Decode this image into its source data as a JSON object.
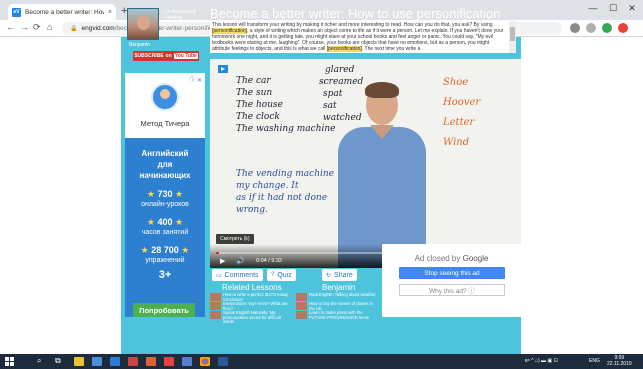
{
  "browser": {
    "tab_title": "Become a better writer: How to u",
    "tab_close": "×",
    "new_tab": "+",
    "url_host": "engvid.com",
    "url_path": "/become-a-better-writer-personification/",
    "back": "←",
    "forward": "→",
    "reload": "⟳",
    "home": "⌂",
    "lock": "🔒",
    "minimize": "—",
    "maximize": "☐",
    "close": "✕",
    "favicon": "eV"
  },
  "teacher": {
    "name": "Benjamin",
    "levels": [
      "• 3-Advanced",
      "• writing"
    ],
    "subscribe_label": "SUBSCRIBE",
    "subscribe_on": "on",
    "youtube": "You Tube"
  },
  "lesson": {
    "title": "Become a better writer: How to use personification",
    "text_parts": [
      "This lesson will transform your writing by making it richer and more interesting to read. How can you do that, you ask? By using ",
      "[personification]",
      ", a style of writing which makes an object come to life as if it were a person. Let me explain. If you haven't done your homework one night, and it is getting late, you might stare at your school books and feel anger or panic. You could say, \"My evil textbooks were staring at me, laughing\". Of course, your books are objects that have no emotions, but as a person, you might attribute feelings to objects, and this is what we call ",
      "[personification]",
      ". The next time you write a"
    ]
  },
  "left_ad": {
    "info": "ⓘ ✕",
    "brand": "Метод Тичера",
    "headline": [
      "Английский",
      "для",
      "начинающих"
    ],
    "stats": [
      {
        "num": "730",
        "label": "онлайн-уроков"
      },
      {
        "num": "400",
        "label": "часов занятий"
      },
      {
        "num": "28 700",
        "label": "упражнений"
      }
    ],
    "plus": "3+",
    "button": "Попробовать"
  },
  "video": {
    "whiteboard_left": [
      "The car",
      "The sun",
      "The house",
      "The clock",
      "The washing machine"
    ],
    "whiteboard_mid": [
      "glared",
      "screamed",
      "spat",
      "sat",
      "watched"
    ],
    "whiteboard_right": [
      "Shoe",
      "Hoover",
      "Letter",
      "Wind"
    ],
    "whiteboard_sentence": [
      "The vending machine",
      "my change. It",
      "as if it had not done",
      "wrong."
    ],
    "watch_later": "Смотреть (k)",
    "time": "0:04 / 9:32",
    "progress": 0.01,
    "play": "▶",
    "volume": "🔊",
    "settings": "⚙",
    "fullscreen": "⛶",
    "yt_mark": "▶"
  },
  "tabs": [
    {
      "icon": "▭",
      "label": "Comments"
    },
    {
      "icon": "?",
      "label": "Quiz"
    },
    {
      "icon": "↻",
      "label": "Share"
    }
  ],
  "related": {
    "heading_left": "Related Lessons",
    "heading_right": "Benjamin",
    "left_items": [
      "How to write a perfect IELTS essay conclusion",
      "Interjections! Yay! Hmm? What are they?",
      "Speak English Naturally: My pronunciation secret for difficult words"
    ],
    "right_items": [
      "Real English: Talking about weather",
      "How to say the names of places in the UK",
      "Learn to make plans with the FUTURE PROGRESSIVE tense"
    ]
  },
  "right_ad": {
    "closed_by": "Ad closed by",
    "google": "Google",
    "stop_label": "Stop seeing this ad",
    "why_label": "Why this ad? ⓘ"
  },
  "taskbar": {
    "lang": "ENG",
    "time": "9:09",
    "date": "22.11.2019",
    "tray": "ʀ⁸ ^ ⌂) ▬ ▣ ⊡",
    "search": "⌕",
    "task_view": "⧉"
  },
  "colors": {
    "site_bg": "#4ec4dc",
    "brand_blue": "#1e88e5",
    "ad_blue": "#2d7fd0",
    "google_blue": "#4285f4",
    "subscribe_red": "#d0352f",
    "taskbar": "#1e2b3c"
  }
}
